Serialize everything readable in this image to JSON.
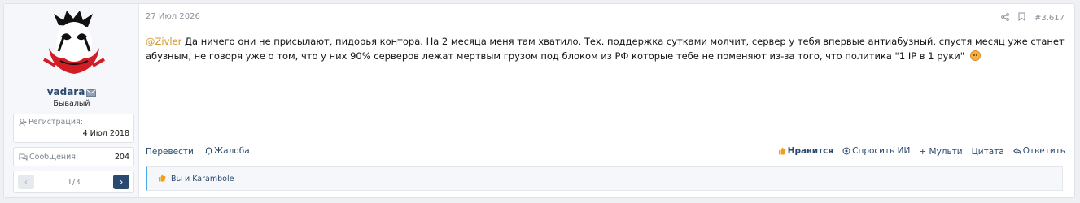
{
  "user": {
    "name": "vadara",
    "title": "Бывалый",
    "registration_label": "Регистрация:",
    "registration_value": "4 Июл 2018",
    "messages_label": "Сообщения:",
    "messages_value": "204",
    "pager": "1/3"
  },
  "post": {
    "date": "27 Июл 2026",
    "number": "#3.617",
    "mention": "@Zivler",
    "text": " Да ничего они не присылают, пидорья контора. На 2 месяца меня там хватило. Тех. поддержка сутками молчит, сервер у тебя впервые антиабузный, спустя месяц уже станет абузным, не говоря уже о том, что у них 90% серверов лежат мертвым грузом под блоком из РФ которые тебе не поменяют из-за того, что политика \"1 IP в 1 руки\" "
  },
  "actions": {
    "translate": "Перевести",
    "report": "Жалоба",
    "like": "Нравится",
    "ask_ai": "Спросить ИИ",
    "multi": "Мульти",
    "quote": "Цитата",
    "reply": "Ответить"
  },
  "likes": {
    "text": "Вы и Karambole"
  },
  "colors": {
    "accent": "#2b4a6f",
    "mention": "#d4962a",
    "like_icon": "#f0a020",
    "likes_bar_border": "#47a7eb"
  }
}
